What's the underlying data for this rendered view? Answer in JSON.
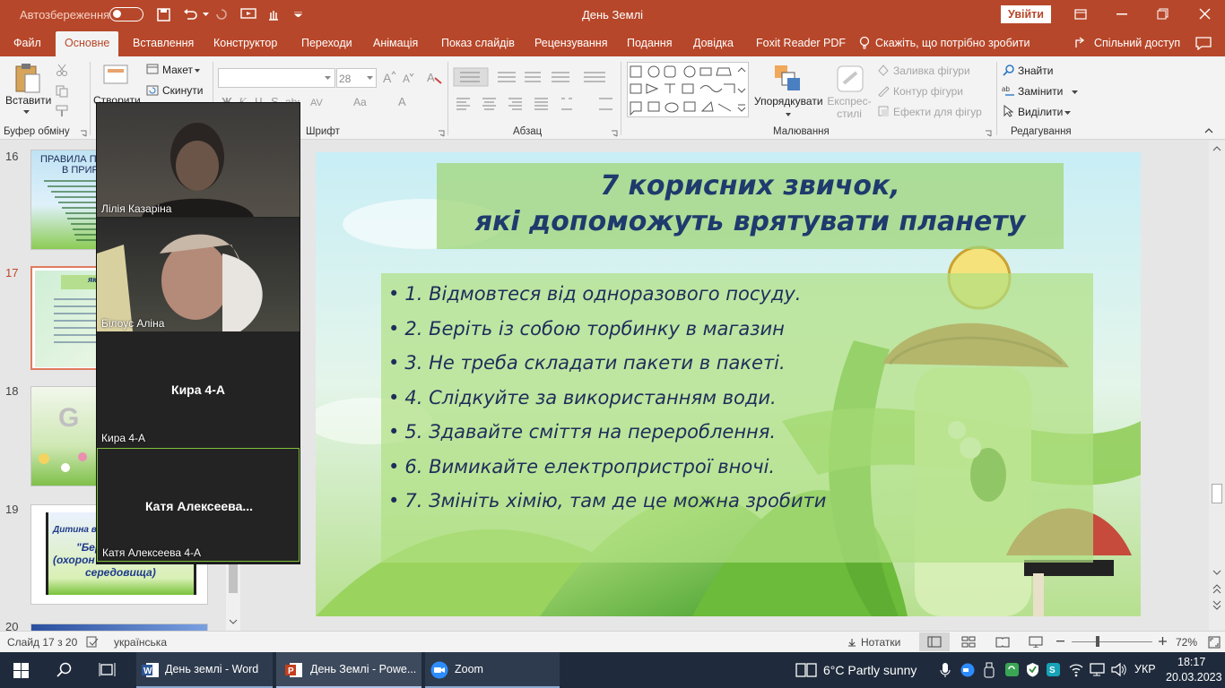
{
  "titlebar": {
    "autosave": "Автозбереження",
    "doc_title": "День Землі",
    "signin": "Увійти"
  },
  "tabs": [
    "Файл",
    "Основне",
    "Вставлення",
    "Конструктор",
    "Переходи",
    "Анімація",
    "Показ слайдів",
    "Рецензування",
    "Подання",
    "Довідка",
    "Foxit Reader PDF",
    "Скажіть, що потрібно зробити",
    "Спільний доступ"
  ],
  "ribbon": {
    "clipboard": {
      "paste": "Вставити",
      "group": "Буфер обміну"
    },
    "slides": {
      "new": "Створити",
      "layout": "Макет",
      "reset": "Скинути"
    },
    "font": {
      "size": "28",
      "group": "Шрифт"
    },
    "paragraph": {
      "group": "Абзац"
    },
    "drawing": {
      "arrange": "Упорядкувати",
      "quick_styles": "Експрес-стилі",
      "fill": "Заливка фігури",
      "outline": "Контур фігури",
      "effects": "Ефекти для фігур",
      "group": "Малювання"
    },
    "editing": {
      "find": "Знайти",
      "replace": "Замінити",
      "select": "Виділити",
      "group": "Редагування"
    }
  },
  "thumbnails": [
    {
      "num": "16",
      "line1": "ПРАВИЛА ПО",
      "line2": "В ПРИР"
    },
    {
      "num": "17",
      "line1": "які допомо"
    },
    {
      "num": "18",
      "line1": "G"
    },
    {
      "num": "19",
      "line1": "Дитина в",
      "line2": "\"Бер",
      "line3": "(охорон",
      "line4": "середовища)"
    },
    {
      "num": "20"
    }
  ],
  "slide": {
    "title_line1": "7 корисних звичок,",
    "title_line2": "які допоможуть врятувати планету",
    "bullets": [
      "1. Відмовтеся від одноразового посуду.",
      "2. Беріть із собою торбинку в магазин",
      "3. Не треба складати пакети в пакеті.",
      "4. Слідкуйте за використанням води.",
      "5. Здавайте сміття на перероблення.",
      "6. Вимикайте електропристрої вночі.",
      "7. Змініть хімію, там де це можна зробити"
    ]
  },
  "zoom": {
    "participants": [
      {
        "label": "Лілія Казаріна",
        "big": ""
      },
      {
        "label": "Білоус Аліна",
        "big": ""
      },
      {
        "label": "Кира 4-А",
        "big": "Кира 4-А"
      },
      {
        "label": "Катя Алексеева 4-А",
        "big": "Катя  Алексеева..."
      }
    ]
  },
  "status": {
    "slide": "Слайд 17 з 20",
    "lang": "українська",
    "notes": "Нотатки",
    "zoom": "72%"
  },
  "taskbar": {
    "apps": [
      {
        "label": "День землі - Word"
      },
      {
        "label": "День Землі - Powe..."
      },
      {
        "label": "Zoom"
      }
    ],
    "weather": "6°C  Partly sunny",
    "lang": "УКР",
    "time": "18:17",
    "date": "20.03.2023"
  },
  "colors": {
    "accent": "#b7472a",
    "title_text": "#1f3a6d",
    "slide_text": "#1f2d5a"
  }
}
